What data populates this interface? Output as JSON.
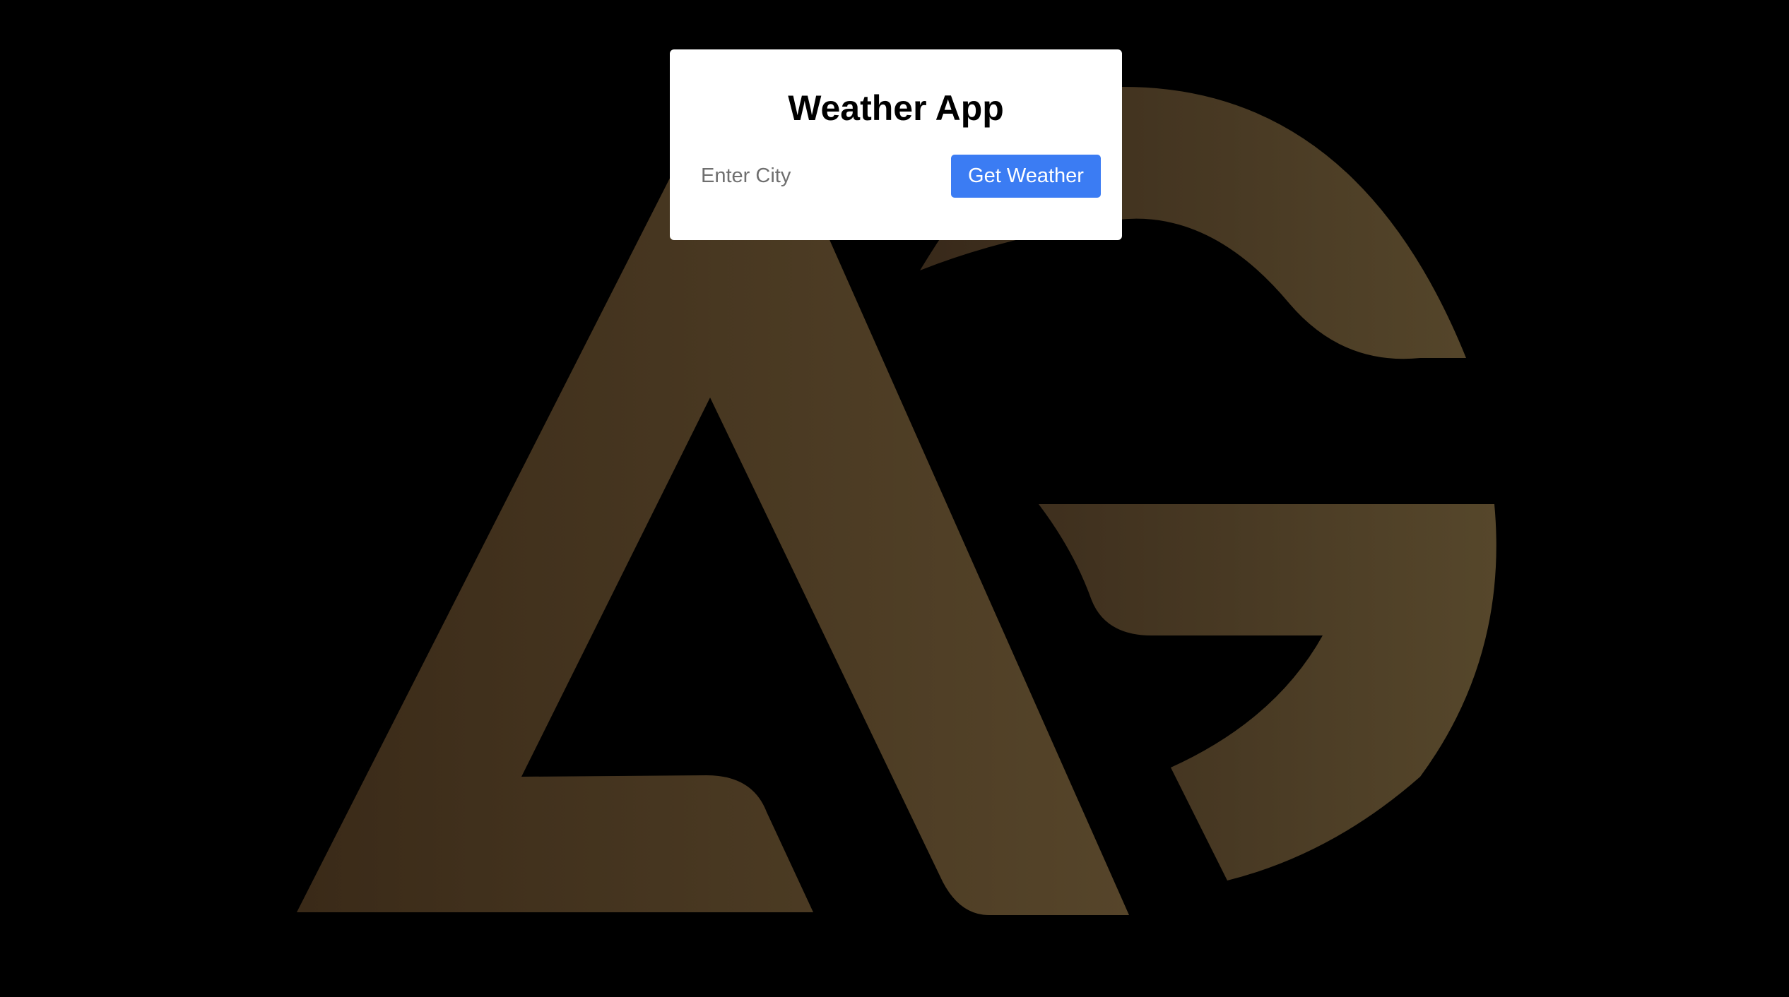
{
  "app": {
    "title": "Weather App"
  },
  "search": {
    "placeholder": "Enter City",
    "value": ""
  },
  "actions": {
    "get_weather_label": "Get Weather"
  },
  "background": {
    "logo_letters": "AG",
    "colors": {
      "page": "#000000",
      "logo_dark": "#3a2a18",
      "logo_light": "#564629"
    }
  },
  "colors": {
    "card": "#ffffff",
    "button": "#3b7cf3",
    "button_text": "#ffffff",
    "title": "#000000",
    "placeholder": "#6f6f6f"
  }
}
